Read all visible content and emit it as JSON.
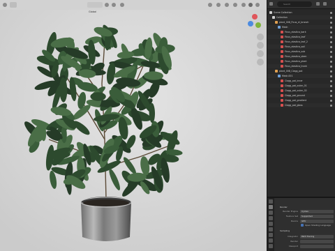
{
  "viewport": {
    "bg_color": "#d7d7d7",
    "header_label": "Global",
    "icons": [
      "editor-type-icon",
      "view-menu-icon",
      "cursor-icon",
      "move-icon",
      "rotate-icon",
      "scale-icon",
      "transform-orientation-icon",
      "pivot-icon",
      "snap-icon",
      "proportional-icon",
      "overlay-icon",
      "xray-icon",
      "shading-solid-icon",
      "shading-material-icon",
      "shading-rendered-icon"
    ],
    "gizmo": {
      "x_color": "#e0565b",
      "y_color": "#7fb43c",
      "z_color": "#4c8be0"
    }
  },
  "outliner": {
    "search_placeholder": "Search",
    "title": "Scene Collection",
    "rows": [
      {
        "indent": 0,
        "label": "Scene Collection",
        "icon_color": "#cfcfcf"
      },
      {
        "indent": 1,
        "label": "Collection",
        "icon_color": "#cfcfcf"
      },
      {
        "indent": 2,
        "label": "plant_008_Ficus_el_branch",
        "icon_color": "#e0a050"
      },
      {
        "indent": 3,
        "label": "Mesh",
        "icon_color": "#6fa0d8"
      },
      {
        "indent": 4,
        "label": "Ficus_elastica_bark",
        "icon_color": "#d85050"
      },
      {
        "indent": 4,
        "label": "Ficus_elastica_leaf",
        "icon_color": "#d85050"
      },
      {
        "indent": 4,
        "label": "Ficus_elastica_leaf_2",
        "icon_color": "#d85050"
      },
      {
        "indent": 4,
        "label": "Ficus_elastica_soil",
        "icon_color": "#d85050"
      },
      {
        "indent": 4,
        "label": "Ficus_elastica_sub",
        "icon_color": "#d85050"
      },
      {
        "indent": 4,
        "label": "Ficus_elastica_stem",
        "icon_color": "#d85050"
      },
      {
        "indent": 4,
        "label": "Ficus_elastica_plant",
        "icon_color": "#d85050"
      },
      {
        "indent": 4,
        "label": "Ficus_elastica_trunk",
        "icon_color": "#d85050"
      },
      {
        "indent": 2,
        "label": "plant_008_Clagg_pot",
        "icon_color": "#e0a050"
      },
      {
        "indent": 3,
        "label": "Mesh.001",
        "icon_color": "#6fa0d8"
      },
      {
        "indent": 4,
        "label": "Clagg_pot_inner",
        "icon_color": "#d85050"
      },
      {
        "indent": 4,
        "label": "Clagg_pot_outer_01",
        "icon_color": "#d85050"
      },
      {
        "indent": 4,
        "label": "Clagg_pot_outer_02",
        "icon_color": "#d85050"
      },
      {
        "indent": 4,
        "label": "Clagg_pot_ground",
        "icon_color": "#d85050"
      },
      {
        "indent": 4,
        "label": "Clagg_pot_gradient",
        "icon_color": "#d85050"
      },
      {
        "indent": 4,
        "label": "Clagg_pot_gloss",
        "icon_color": "#d85050"
      }
    ]
  },
  "properties": {
    "panel_title": "Render",
    "fields": [
      {
        "label": "Render Engine",
        "value": "Cycles"
      },
      {
        "label": "Feature Set",
        "value": "Supported"
      },
      {
        "label": "Device",
        "value": "GPU"
      }
    ],
    "checkbox_label": "Open Shading Language",
    "section_title": "Sampling",
    "fields2": [
      {
        "label": "Integrator",
        "value": "Path Tracing"
      },
      {
        "label": "Render",
        "value": ""
      },
      {
        "label": "Viewport",
        "value": ""
      }
    ]
  }
}
